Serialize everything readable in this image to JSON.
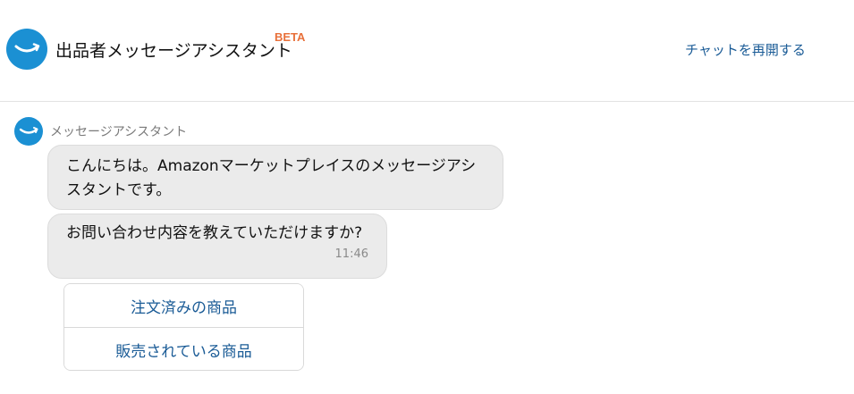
{
  "header": {
    "logo_icon": "amazon-smile-icon",
    "title": "出品者メッセージアシスタント",
    "badge": "BETA",
    "restart_link": "チャットを再開する"
  },
  "colors": {
    "brand_blue": "#1b90d3",
    "link_blue": "#1a5b96",
    "beta_orange": "#e8703a",
    "bubble_bg": "#ebebeb"
  },
  "chat": {
    "sender": "メッセージアシスタント",
    "avatar_icon": "amazon-smile-icon",
    "messages": [
      {
        "text": "こんにちは。Amazonマーケットプレイスのメッセージアシスタントです。"
      },
      {
        "text": "お問い合わせ内容を教えていただけますか?",
        "time": "11:46"
      }
    ],
    "options": [
      {
        "label": "注文済みの商品"
      },
      {
        "label": "販売されている商品"
      }
    ]
  }
}
